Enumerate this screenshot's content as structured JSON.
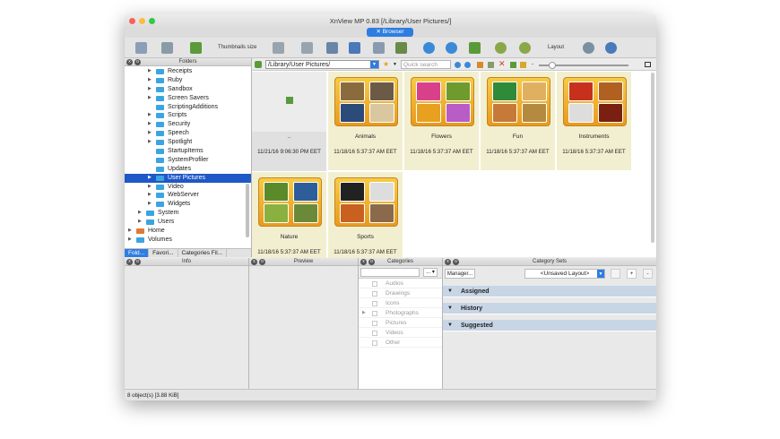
{
  "window": {
    "title": "XnView MP 0.83 [/Library/User Pictures/]",
    "tab": "Browser"
  },
  "toolbar": {
    "thumbnails_size": "Thumbnails size",
    "layout": "Layout"
  },
  "left_panel": {
    "header": "Folders",
    "tree": [
      {
        "label": "Receipts",
        "level": 2,
        "expander": true
      },
      {
        "label": "Ruby",
        "level": 2,
        "expander": true
      },
      {
        "label": "Sandbox",
        "level": 2,
        "expander": true
      },
      {
        "label": "Screen Savers",
        "level": 2,
        "expander": true
      },
      {
        "label": "ScriptingAdditions",
        "level": 2,
        "expander": false
      },
      {
        "label": "Scripts",
        "level": 2,
        "expander": true
      },
      {
        "label": "Security",
        "level": 2,
        "expander": true
      },
      {
        "label": "Speech",
        "level": 2,
        "expander": true
      },
      {
        "label": "Spotlight",
        "level": 2,
        "expander": true
      },
      {
        "label": "StartupItems",
        "level": 2,
        "expander": false
      },
      {
        "label": "SystemProfiler",
        "level": 2,
        "expander": false
      },
      {
        "label": "Updates",
        "level": 2,
        "expander": false
      },
      {
        "label": "User Pictures",
        "level": 2,
        "expander": true,
        "selected": true
      },
      {
        "label": "Video",
        "level": 2,
        "expander": true
      },
      {
        "label": "WebServer",
        "level": 2,
        "expander": true
      },
      {
        "label": "Widgets",
        "level": 2,
        "expander": true
      },
      {
        "label": "System",
        "level": 1,
        "expander": true
      },
      {
        "label": "Users",
        "level": 1,
        "expander": true
      },
      {
        "label": "Home",
        "level": 0,
        "expander": true,
        "home": true
      },
      {
        "label": "Volumes",
        "level": 0,
        "expander": true
      }
    ],
    "bottom_tabs": [
      "Fold...",
      "Favori...",
      "Categories Fil..."
    ]
  },
  "browser": {
    "path": "/Library/User Pictures/",
    "search_placeholder": "Quick search",
    "items": [
      {
        "name": "..",
        "date": "11/21/16 9:06:30 PM EET",
        "kind": "parent"
      },
      {
        "name": "Animals",
        "date": "11/18/16 5:37:37 AM EET",
        "colors": [
          "#8a6b3e",
          "#6b5a45",
          "#2c4a7a",
          "#d9c7a0"
        ]
      },
      {
        "name": "Flowers",
        "date": "11/18/16 5:37:37 AM EET",
        "colors": [
          "#d9408a",
          "#6f9a2e",
          "#e8a020",
          "#b85cc6"
        ]
      },
      {
        "name": "Fun",
        "date": "11/18/16 5:37:37 AM EET",
        "colors": [
          "#2f8a3a",
          "#e0b060",
          "#c57a3a",
          "#b48a40"
        ]
      },
      {
        "name": "Instruments",
        "date": "11/18/16 5:37:37 AM EET",
        "colors": [
          "#c8301e",
          "#b06020",
          "#dddddd",
          "#7a2010"
        ]
      },
      {
        "name": "Nature",
        "date": "11/18/16 5:37:37 AM EET",
        "colors": [
          "#5a8a2a",
          "#2e5e9a",
          "#8ab040",
          "#6a8a3a"
        ]
      },
      {
        "name": "Sports",
        "date": "11/18/16 5:37:37 AM EET",
        "colors": [
          "#222222",
          "#dddddd",
          "#c86020",
          "#8a6a4a"
        ]
      }
    ]
  },
  "panels": {
    "info": "Info",
    "preview": "Preview",
    "categories": "Categories",
    "category_sets": "Category Sets",
    "manager_btn": "Manager...",
    "layout_select": "<Unsaved Layout>"
  },
  "categories": [
    "Audios",
    "Drawings",
    "Icons",
    "Photographs",
    "Pictures",
    "Videos",
    "Other"
  ],
  "category_sets": [
    "Assigned",
    "History",
    "Suggested"
  ],
  "status": "8 object(s) [3.88 KiB]",
  "colors": {
    "accent": "#2e7de1",
    "thumb_bg": "#f2efd1",
    "selection": "#1f58c7",
    "set_row": "#c7d5e5"
  }
}
